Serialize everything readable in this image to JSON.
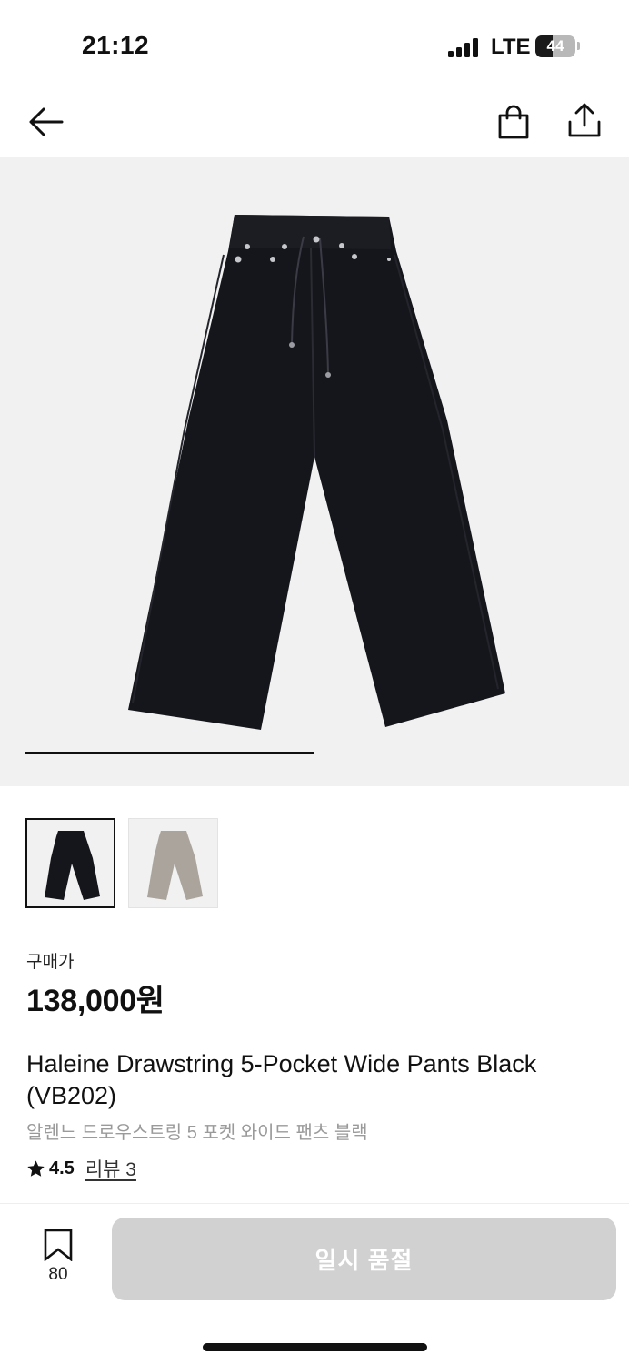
{
  "status_bar": {
    "time": "21:12",
    "network": "LTE",
    "battery_level": "44",
    "battery_fraction": 0.44
  },
  "header": {
    "back_icon": "arrow-left-icon",
    "bag_icon": "shopping-bag-icon",
    "share_icon": "share-icon"
  },
  "gallery": {
    "image_count": 2,
    "current_index": 1,
    "progress_fraction": 0.5,
    "thumbnails": [
      {
        "color_name": "Black",
        "swatch": "#15161b",
        "selected": true
      },
      {
        "color_name": "Gray",
        "swatch": "#aaa49c",
        "selected": false
      }
    ]
  },
  "product": {
    "price_label": "구매가",
    "price": "138,000원",
    "title_en": "Haleine Drawstring 5-Pocket Wide Pants Black (VB202)",
    "title_ko": "알렌느 드로우스트링 5 포켓 와이드 팬츠 블랙",
    "rating": "4.5",
    "review_label": "리뷰 3"
  },
  "bottom_bar": {
    "bookmark_icon": "bookmark-icon",
    "bookmark_count": "80",
    "cta_label": "일시 품절"
  },
  "colors": {
    "accent": "#111111",
    "soldout_button": "#d1d1d1",
    "subtext": "#9a9a9a",
    "hero_background": "#f1f1f1"
  }
}
